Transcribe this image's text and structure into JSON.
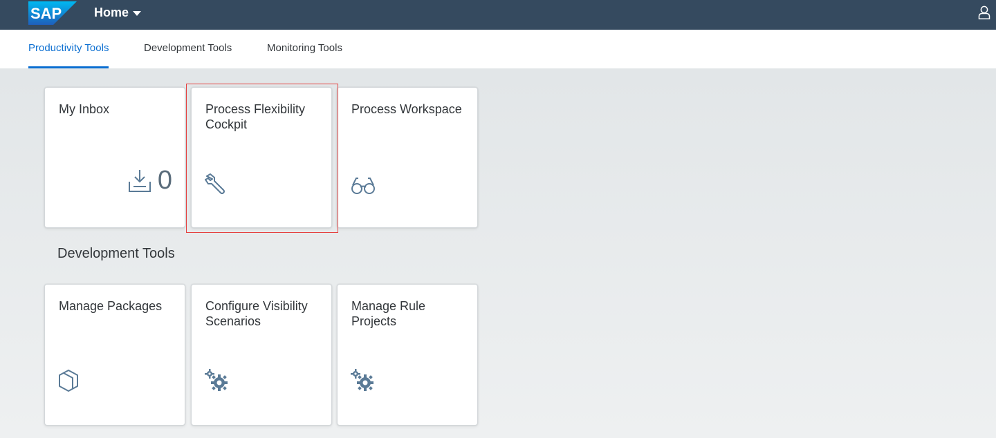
{
  "shell": {
    "logo_text": "SAP",
    "title": "Home",
    "title_icon": "caret-down-icon",
    "user_icon": "person-icon"
  },
  "tabs": [
    {
      "label": "Productivity Tools",
      "active": true
    },
    {
      "label": "Development Tools",
      "active": false
    },
    {
      "label": "Monitoring Tools",
      "active": false
    }
  ],
  "groups": [
    {
      "title": "",
      "tiles": [
        {
          "title": "My Inbox",
          "icon": "inbox-download-icon",
          "kpi": "0"
        },
        {
          "title": "Process Flexibility Cockpit",
          "icon": "wrench-icon",
          "highlighted": true
        },
        {
          "title": "Process Workspace",
          "icon": "glasses-icon"
        }
      ]
    },
    {
      "title": "Development Tools",
      "tiles": [
        {
          "title": "Manage Packages",
          "icon": "package-icon"
        },
        {
          "title": "Configure Visibility Scenarios",
          "icon": "gears-icon"
        },
        {
          "title": "Manage Rule Projects",
          "icon": "gears-icon"
        }
      ]
    }
  ],
  "colors": {
    "shell_bg": "#354a5f",
    "accent": "#0a6ed1",
    "icon": "#5a7a96",
    "highlight": "#e5403f"
  }
}
